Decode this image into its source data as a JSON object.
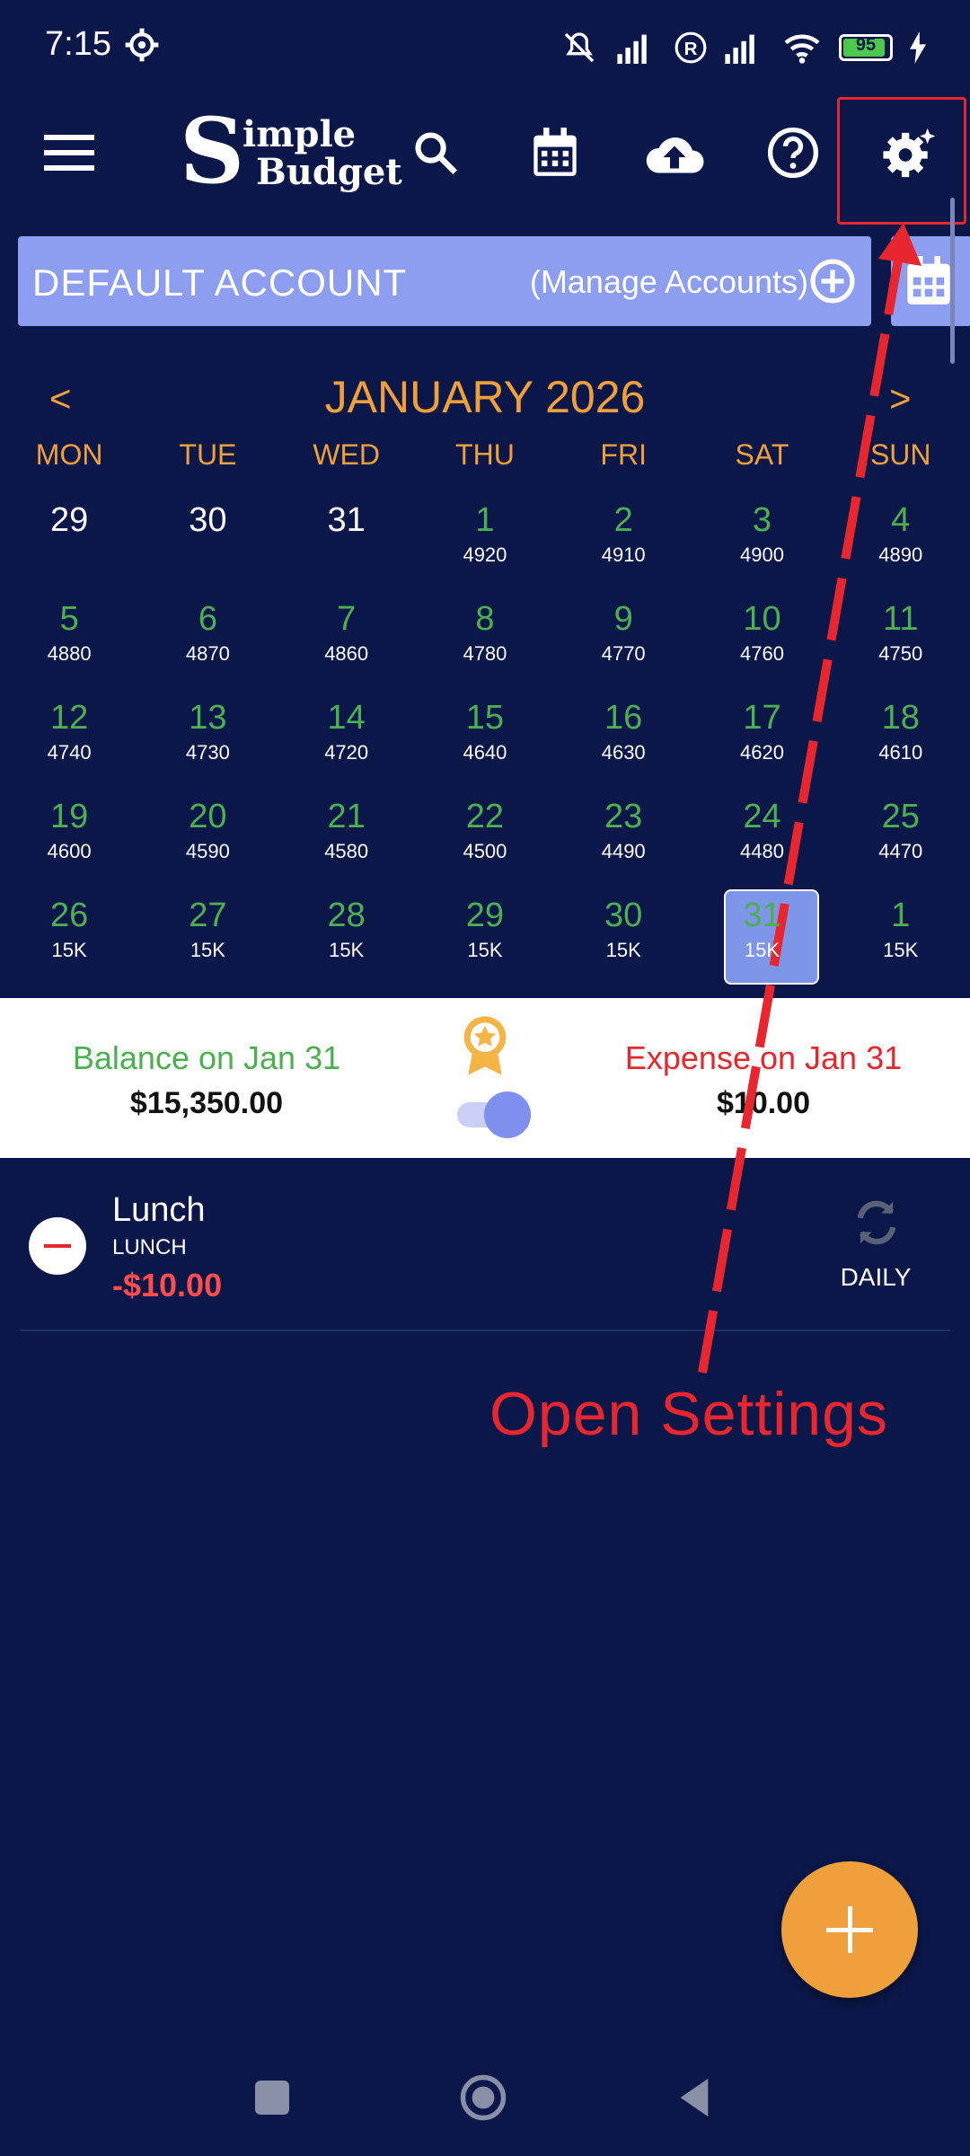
{
  "status_bar": {
    "time": "7:15",
    "battery": "95"
  },
  "account": {
    "name": "DEFAULT ACCOUNT",
    "manage_label": "(Manage Accounts)"
  },
  "calendar": {
    "prev": "<",
    "next": ">",
    "month_title": "JANUARY 2026",
    "weekdays": [
      "MON",
      "TUE",
      "WED",
      "THU",
      "FRI",
      "SAT",
      "SUN"
    ],
    "weeks": [
      [
        {
          "d": "29",
          "a": "",
          "kind": "prev"
        },
        {
          "d": "30",
          "a": "",
          "kind": "prev"
        },
        {
          "d": "31",
          "a": "",
          "kind": "prev"
        },
        {
          "d": "1",
          "a": "4920",
          "kind": "cur"
        },
        {
          "d": "2",
          "a": "4910",
          "kind": "cur"
        },
        {
          "d": "3",
          "a": "4900",
          "kind": "cur"
        },
        {
          "d": "4",
          "a": "4890",
          "kind": "cur"
        }
      ],
      [
        {
          "d": "5",
          "a": "4880",
          "kind": "cur"
        },
        {
          "d": "6",
          "a": "4870",
          "kind": "cur"
        },
        {
          "d": "7",
          "a": "4860",
          "kind": "cur"
        },
        {
          "d": "8",
          "a": "4780",
          "kind": "cur"
        },
        {
          "d": "9",
          "a": "4770",
          "kind": "cur"
        },
        {
          "d": "10",
          "a": "4760",
          "kind": "cur"
        },
        {
          "d": "11",
          "a": "4750",
          "kind": "cur"
        }
      ],
      [
        {
          "d": "12",
          "a": "4740",
          "kind": "cur"
        },
        {
          "d": "13",
          "a": "4730",
          "kind": "cur"
        },
        {
          "d": "14",
          "a": "4720",
          "kind": "cur"
        },
        {
          "d": "15",
          "a": "4640",
          "kind": "cur"
        },
        {
          "d": "16",
          "a": "4630",
          "kind": "cur"
        },
        {
          "d": "17",
          "a": "4620",
          "kind": "cur"
        },
        {
          "d": "18",
          "a": "4610",
          "kind": "cur"
        }
      ],
      [
        {
          "d": "19",
          "a": "4600",
          "kind": "cur"
        },
        {
          "d": "20",
          "a": "4590",
          "kind": "cur"
        },
        {
          "d": "21",
          "a": "4580",
          "kind": "cur"
        },
        {
          "d": "22",
          "a": "4500",
          "kind": "cur"
        },
        {
          "d": "23",
          "a": "4490",
          "kind": "cur"
        },
        {
          "d": "24",
          "a": "4480",
          "kind": "cur"
        },
        {
          "d": "25",
          "a": "4470",
          "kind": "cur"
        }
      ],
      [
        {
          "d": "26",
          "a": "15K",
          "kind": "cur"
        },
        {
          "d": "27",
          "a": "15K",
          "kind": "cur"
        },
        {
          "d": "28",
          "a": "15K",
          "kind": "cur"
        },
        {
          "d": "29",
          "a": "15K",
          "kind": "cur"
        },
        {
          "d": "30",
          "a": "15K",
          "kind": "cur"
        },
        {
          "d": "31",
          "a": "15K",
          "kind": "cur",
          "selected": true
        },
        {
          "d": "1",
          "a": "15K",
          "kind": "cur"
        }
      ]
    ]
  },
  "summary": {
    "balance_label": "Balance on Jan 31",
    "balance_value": "$15,350.00",
    "expense_label": "Expense on Jan 31",
    "expense_value": "$10.00"
  },
  "transaction": {
    "name": "Lunch",
    "category": "LUNCH",
    "amount": "-$10.00",
    "frequency": "DAILY"
  },
  "annotation": {
    "text": "Open Settings"
  },
  "colors": {
    "background": "#0a1748",
    "accent_orange": "#f0a03a",
    "account_bar": "#8d9ef0",
    "positive_green": "#4caf50",
    "negative_red": "#e8262f"
  }
}
